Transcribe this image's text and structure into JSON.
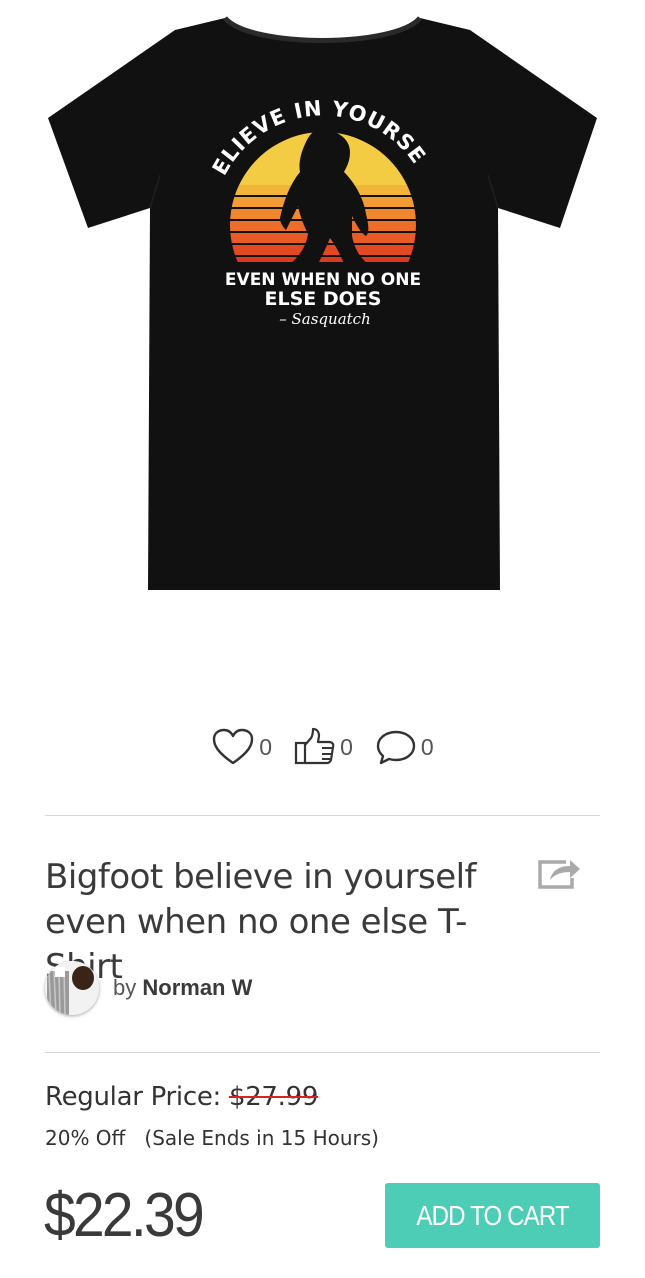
{
  "product": {
    "image_alt": "black t-shirt with bigfoot sunset graphic",
    "print_text": {
      "arc": "BELIEVE IN YOURSELF",
      "line1": "EVEN WHEN NO ONE",
      "line2": "ELSE DOES",
      "signature": "– Sasquatch"
    },
    "title": "Bigfoot believe in yourself even when no one else T-Shirt"
  },
  "social": {
    "likes": "0",
    "thumbs": "0",
    "comments": "0"
  },
  "designer": {
    "prefix": "by",
    "name": "Norman W"
  },
  "pricing": {
    "regular_label": "Regular Price:",
    "regular_price": "$27.99",
    "discount": "20% Off",
    "sale_ends": "(Sale Ends in 15 Hours)",
    "sale_price": "$22.39"
  },
  "actions": {
    "add_to_cart": "ADD TO CART"
  },
  "colors": {
    "accent": "#4ecdb6",
    "strike": "#e02020",
    "shirt": "#111111"
  }
}
